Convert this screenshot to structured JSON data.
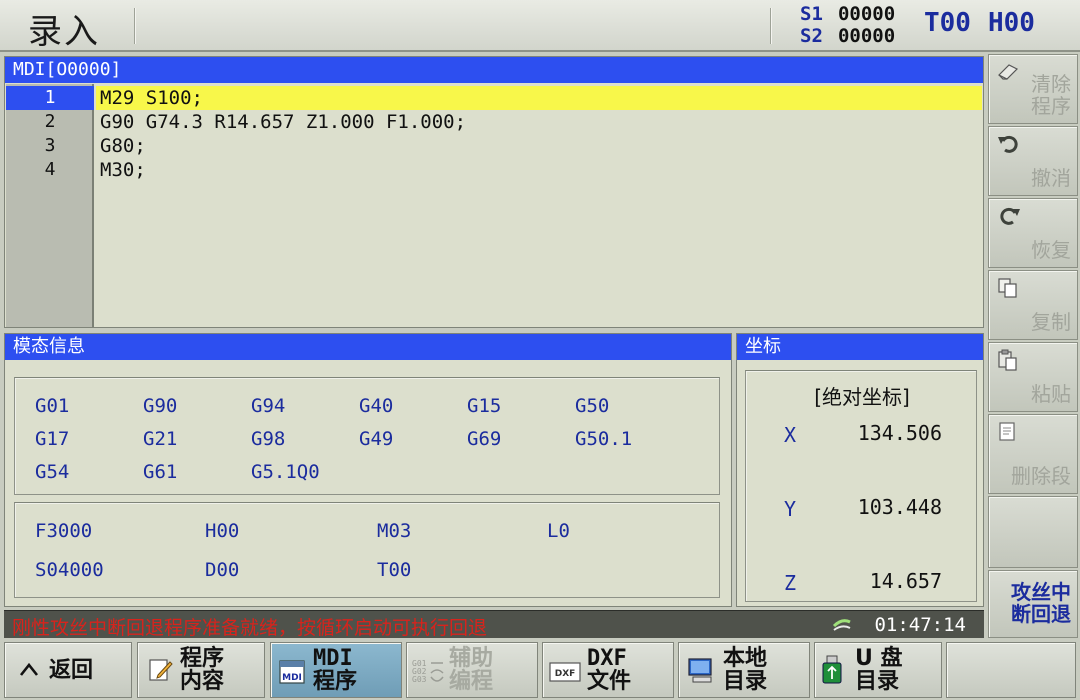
{
  "header": {
    "mode": "录入",
    "s1_label": "S1",
    "s1_value": "00000",
    "s2_label": "S2",
    "s2_value": "00000",
    "tool": "T00",
    "h": "H00"
  },
  "program": {
    "title": "MDI[O0000]",
    "lines": [
      {
        "num": "1",
        "code": "M29 S100;"
      },
      {
        "num": "2",
        "code": "G90 G74.3 R14.657 Z1.000 F1.000;"
      },
      {
        "num": "3",
        "code": "G80;"
      },
      {
        "num": "4",
        "code": "M30;"
      }
    ]
  },
  "modal": {
    "title": "模态信息",
    "gcodes": [
      [
        "G01",
        "G90",
        "G94",
        "G40",
        "G15",
        "G50"
      ],
      [
        "G17",
        "G21",
        "G98",
        "G49",
        "G69",
        "G50.1"
      ],
      [
        "G54",
        "G61",
        "G5.1Q0"
      ]
    ],
    "params": [
      [
        "F3000",
        "H00",
        "M03",
        "L0"
      ],
      [
        "S04000",
        "D00",
        "T00"
      ]
    ]
  },
  "coords": {
    "title": "坐标",
    "subtitle": "[绝对坐标]",
    "x_label": "X",
    "x_value": "134.506",
    "y_label": "Y",
    "y_value": "103.448",
    "z_label": "Z",
    "z_value": "14.657"
  },
  "right_keys": {
    "clear_program": "清除\n程序",
    "undo": "撤消",
    "redo": "恢复",
    "copy": "复制",
    "paste": "粘贴",
    "delete_block": "删除段",
    "tap_retract": "攻丝中\n断回退"
  },
  "status": {
    "alarm": "刚性攻丝中断回退程序准备就绪，按循环启动可执行回退",
    "time": "01:47:14"
  },
  "bottom_keys": {
    "back": "返回",
    "program_content_1": "程序",
    "program_content_2": "内容",
    "mdi_program_1": "MDI",
    "mdi_program_2": "程序",
    "aux_program_1": "辅助",
    "aux_program_2": "编程",
    "dxf_file_1": "DXF",
    "dxf_file_2": "文件",
    "local_dir_1": "本地",
    "local_dir_2": "目录",
    "u_disk_1": "U 盘",
    "u_disk_2": "目录"
  },
  "colors": {
    "accent_blue": "#2d4ff0",
    "highlight_yellow": "#f8f74a",
    "alarm_red": "#d8231c"
  }
}
